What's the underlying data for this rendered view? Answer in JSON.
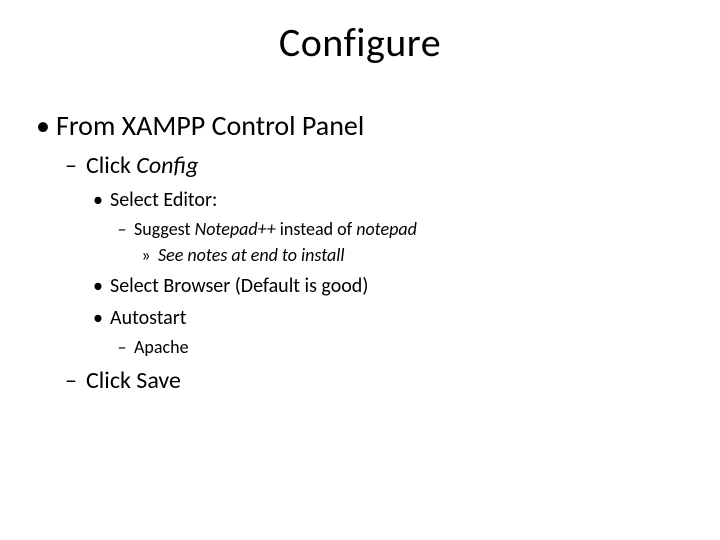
{
  "title": "Configure",
  "markers": {
    "disc": "•",
    "dash": "–",
    "raquo": "»"
  },
  "l1": "From XAMPP Control Panel",
  "l2a_pre": "Click ",
  "l2a_em": "Config",
  "l3a": "Select Editor:",
  "l4a_pre": "Suggest ",
  "l4a_em": "Notepad++ ",
  "l4a_post": "instead of ",
  "l4a_em2": "notepad",
  "l5a": "See notes at end to install",
  "l3b": "Select Browser (Default is good)",
  "l3c": "Autostart",
  "l4b": "Apache",
  "l2b": "Click Save"
}
